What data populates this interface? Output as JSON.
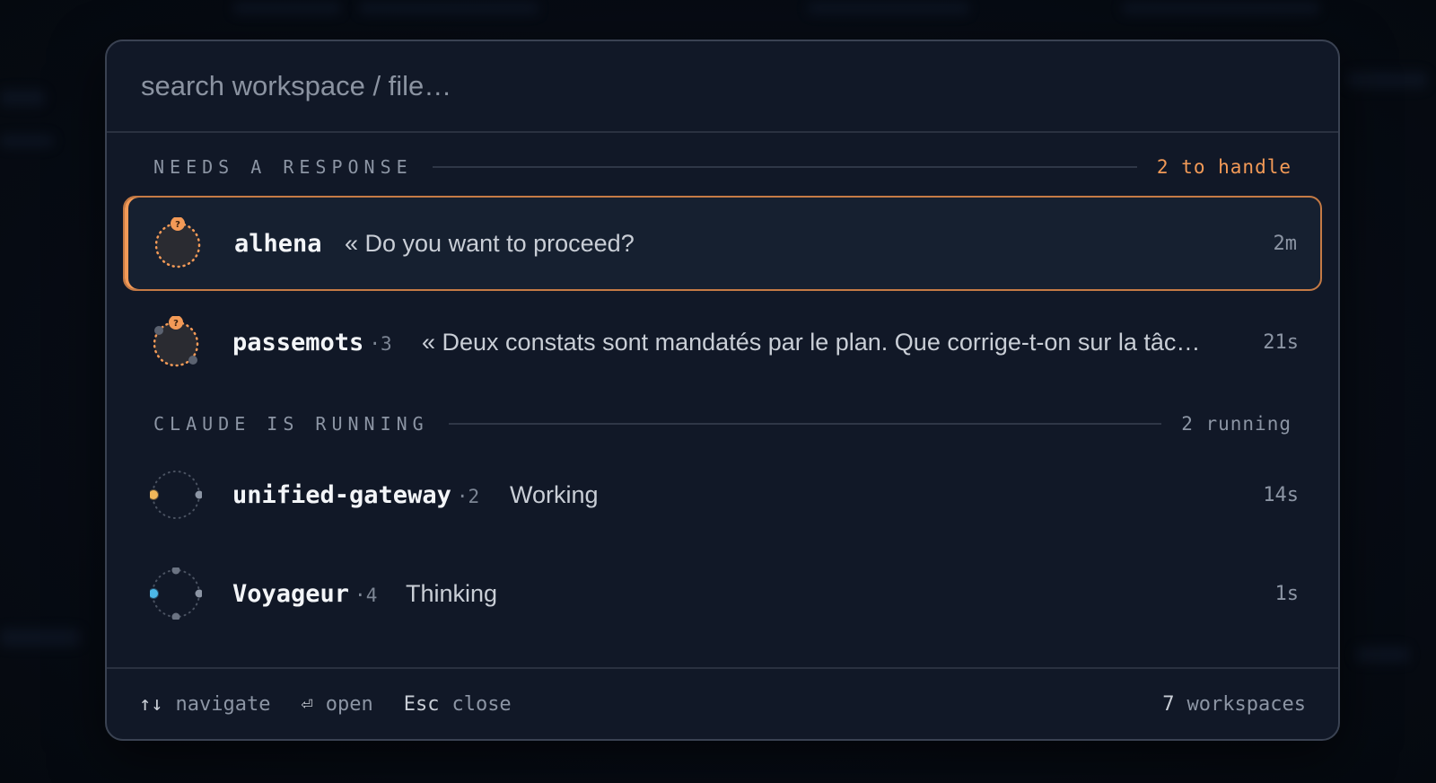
{
  "search": {
    "placeholder": "search workspace / file…"
  },
  "sections": [
    {
      "title": "NEEDS A RESPONSE",
      "count": "2 to handle"
    },
    {
      "title": "CLAUDE IS RUNNING",
      "count": "2 running"
    }
  ],
  "rows": [
    {
      "name": "alhena",
      "sub": "",
      "message": "« Do you want to proceed?",
      "time": "2m"
    },
    {
      "name": "passemots",
      "sub": "·3",
      "message": "« Deux constats sont mandatés par le plan. Que corrige-t-on sur la tâc…",
      "time": "21s"
    },
    {
      "name": "unified-gateway",
      "sub": "·2",
      "message": "Working",
      "time": "14s"
    },
    {
      "name": "Voyageur",
      "sub": "·4",
      "message": "Thinking",
      "time": "1s"
    }
  ],
  "footer": {
    "navigate_key": "↑↓",
    "navigate_label": "navigate",
    "open_key": "⏎",
    "open_label": "open",
    "close_key": "Esc",
    "close_label": "close",
    "workspace_count": "7",
    "workspace_label": "workspaces"
  },
  "colors": {
    "accent_orange": "#f39a57",
    "status_yellow": "#f0b75a",
    "status_blue": "#4cb8e8",
    "panel_bg": "#111827"
  },
  "icons": {
    "question": "?"
  }
}
